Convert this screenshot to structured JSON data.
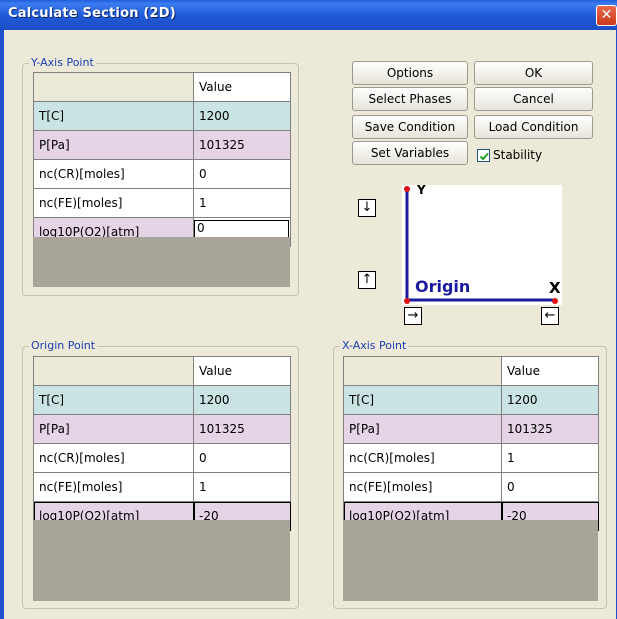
{
  "window": {
    "title": "Calculate Section (2D)",
    "close_glyph": "✕"
  },
  "columns": {
    "value_header": "Value"
  },
  "y_axis_point": {
    "label": "Y-Axis Point",
    "rows": [
      {
        "name": "T[C]",
        "value": "1200"
      },
      {
        "name": "P[Pa]",
        "value": "101325"
      },
      {
        "name": "nc(CR)[moles]",
        "value": "0"
      },
      {
        "name": "nc(FE)[moles]",
        "value": "1"
      },
      {
        "name": "log10P(O2)[atm]",
        "value": "0"
      }
    ]
  },
  "origin_point": {
    "label": "Origin Point",
    "rows": [
      {
        "name": "T[C]",
        "value": "1200"
      },
      {
        "name": "P[Pa]",
        "value": "101325"
      },
      {
        "name": "nc(CR)[moles]",
        "value": "0"
      },
      {
        "name": "nc(FE)[moles]",
        "value": "1"
      },
      {
        "name": "log10P(O2)[atm]",
        "value": "-20"
      }
    ]
  },
  "x_axis_point": {
    "label": "X-Axis Point",
    "rows": [
      {
        "name": "T[C]",
        "value": "1200"
      },
      {
        "name": "P[Pa]",
        "value": "101325"
      },
      {
        "name": "nc(CR)[moles]",
        "value": "1"
      },
      {
        "name": "nc(FE)[moles]",
        "value": "0"
      },
      {
        "name": "log10P(O2)[atm]",
        "value": "-20"
      }
    ]
  },
  "buttons": {
    "options": "Options",
    "ok": "OK",
    "select_phases": "Select Phases",
    "cancel": "Cancel",
    "save_condition": "Save Condition",
    "load_condition": "Load Condition",
    "set_variables": "Set Variables"
  },
  "stability": {
    "label": "Stability",
    "checked": true
  },
  "axis_diagram": {
    "y_label": "Y",
    "x_label": "X",
    "origin_label": "Origin",
    "axis_color": "#1a1aa0",
    "point_color": "#e01010"
  },
  "arrow_buttons": {
    "down": "↓",
    "up": "↑",
    "right": "→",
    "left": "←"
  },
  "colors": {
    "titlebar": "#2058d6",
    "temperature_row": "#c9e4e3",
    "pressure_row": "#e5d3e6",
    "empty_grid": "#a9a699",
    "group_label": "#1a3fb0"
  }
}
